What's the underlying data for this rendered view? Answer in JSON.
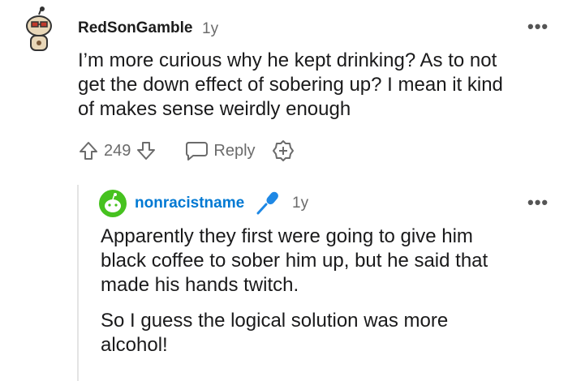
{
  "comment": {
    "username": "RedSonGamble",
    "age": "1y",
    "more_icon": "more-dots-icon",
    "text": "I’m more curious why he kept drinking? As to not get the down effect of sobering up? I mean it kind of makes sense weirdly enough",
    "lines": [
      "I’m more curious why he kept drinking? As to not",
      "get the down effect of sobering up? I mean it kind",
      "of makes sense weirdly enough"
    ],
    "votes": "249",
    "reply_label": "Reply",
    "icons": [
      "upvote-icon",
      "downvote-icon",
      "reply-icon",
      "award-icon"
    ]
  },
  "reply": {
    "username": "nonracistname",
    "age": "1y",
    "flair_icon": "microphone-icon",
    "more_icon": "more-dots-icon",
    "paragraph1": [
      "Apparently they first were going to give him",
      "black coffee to sober him up, but he said that",
      "made his hands twitch."
    ],
    "paragraph2": [
      "So I guess the logical solution was more",
      "alcohol!"
    ]
  },
  "colors": {
    "username_reply": "#0079d3",
    "avatar_reply_bg": "#3fbb1e",
    "muted": "#6b6b6b"
  }
}
